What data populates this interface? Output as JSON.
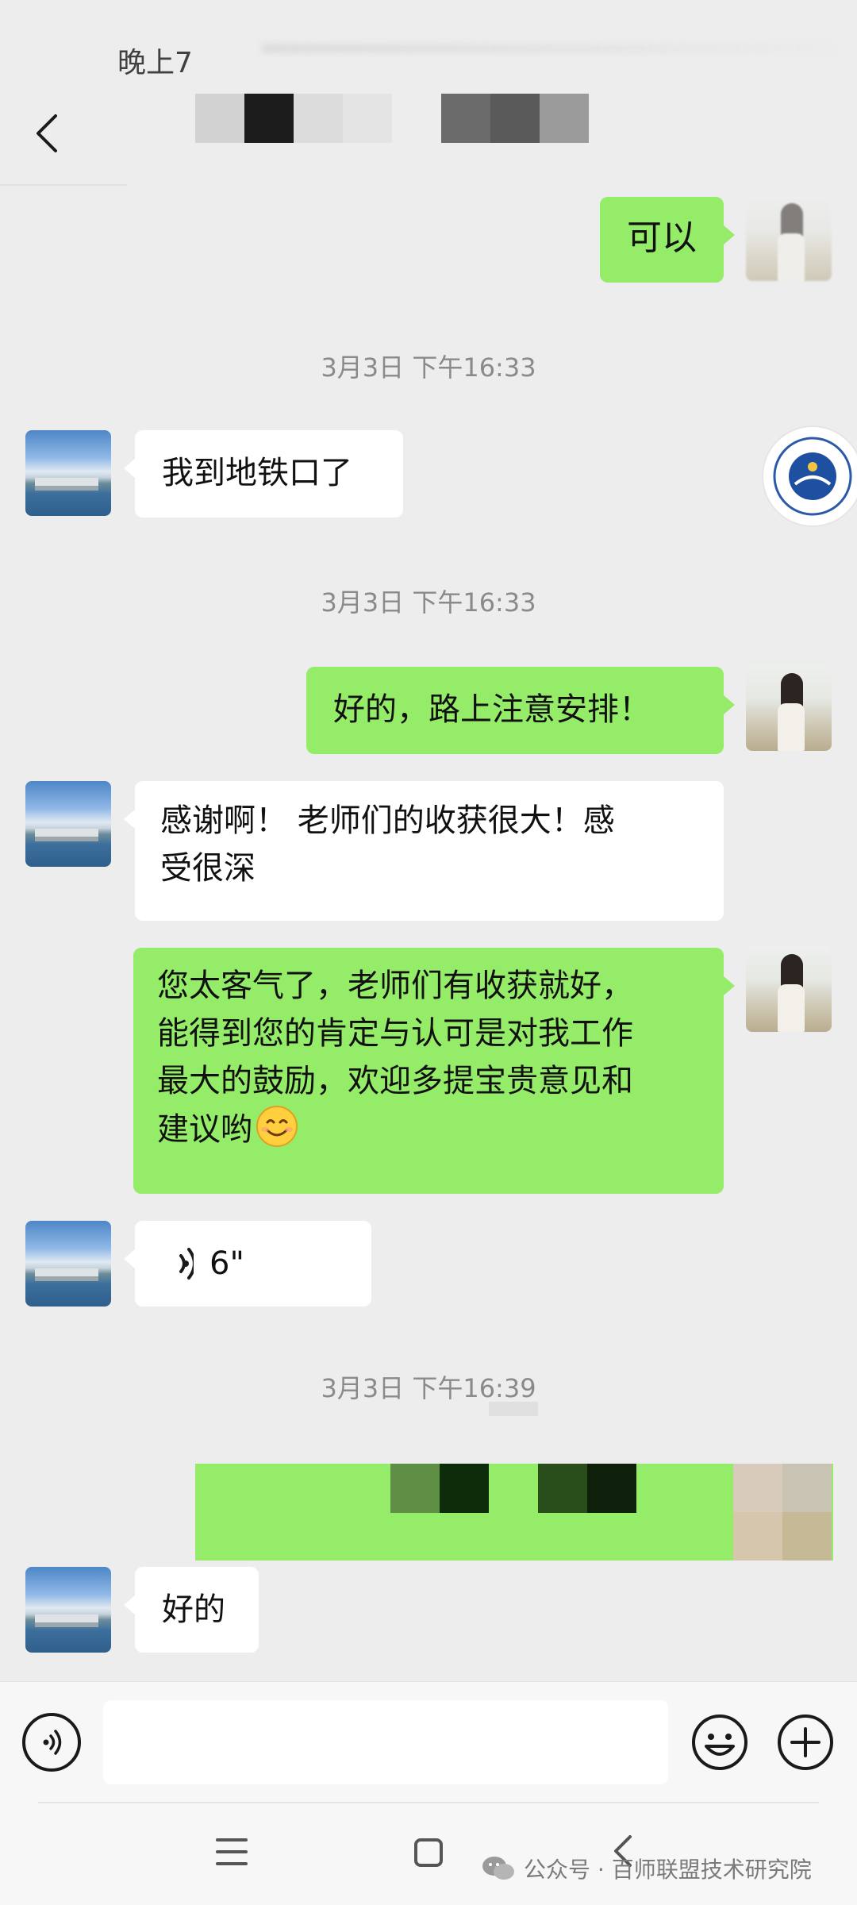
{
  "status": {
    "left_text": "晚上7"
  },
  "header": {
    "back_icon": "chevron-left-icon"
  },
  "messages": [
    {
      "side": "out",
      "type": "text",
      "text": "可以"
    },
    {
      "type": "timestamp",
      "text": "3月3日 下午16:33"
    },
    {
      "side": "in",
      "type": "text",
      "text": "我到地铁口了"
    },
    {
      "type": "timestamp",
      "text": "3月3日 下午16:33"
    },
    {
      "side": "out",
      "type": "text",
      "text": "好的，路上注意安排！"
    },
    {
      "side": "in",
      "type": "text",
      "line1": "感谢啊！ 老师们的收获很大！感",
      "line2": "受很深"
    },
    {
      "side": "out",
      "type": "text",
      "line1": "您太客气了，老师们有收获就好，",
      "line2": "能得到您的肯定与认可是对我工作",
      "line3": "最大的鼓励，欢迎多提宝贵意见和",
      "line4": "建议哟",
      "emoji": "smiling-face-emoji"
    },
    {
      "side": "in",
      "type": "voice",
      "duration": "6\""
    },
    {
      "type": "timestamp",
      "text": "3月3日 下午16:39"
    },
    {
      "side": "out",
      "type": "redacted"
    },
    {
      "side": "in",
      "type": "text",
      "text": "好的"
    }
  ],
  "input_bar": {
    "voice_icon": "voice-icon",
    "input_value": "",
    "emoji_icon": "emoji-icon",
    "plus_icon": "plus-icon"
  },
  "nav_bar": {
    "menu_icon": "menu-icon",
    "home_icon": "home-icon",
    "back_icon": "back-icon"
  },
  "watermark": {
    "text": "公众号 · 百师联盟技术研究院",
    "icon": "wechat-icon"
  },
  "colors": {
    "bubble_out": "#95ec69",
    "bubble_in": "#ffffff",
    "background": "#ededed"
  }
}
